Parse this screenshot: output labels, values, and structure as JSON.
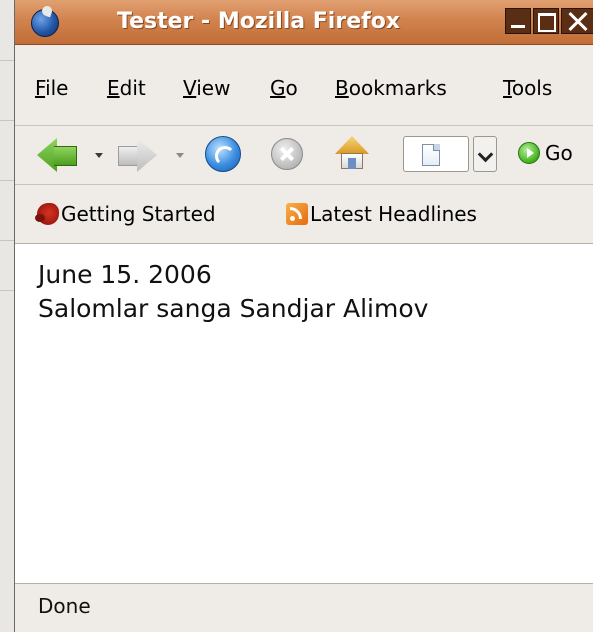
{
  "window": {
    "title": "Tester - Mozilla Firefox"
  },
  "menu": [
    {
      "label": "File",
      "underline": "F",
      "rest": "ile"
    },
    {
      "label": "Edit",
      "underline": "E",
      "rest": "dit"
    },
    {
      "label": "View",
      "underline": "V",
      "rest": "iew"
    },
    {
      "label": "Go",
      "underline": "G",
      "rest": "o"
    },
    {
      "label": "Bookmarks",
      "underline": "B",
      "rest": "ookmarks"
    },
    {
      "label": "Tools",
      "underline": "T",
      "rest": "ools"
    }
  ],
  "toolbar": {
    "go_label": "Go"
  },
  "bookmarks": [
    {
      "label": "Getting Started",
      "icon": "firefox-icon"
    },
    {
      "label": "Latest Headlines",
      "icon": "rss-icon"
    }
  ],
  "content": {
    "lines": [
      "June 15. 2006",
      "Salomlar sanga Sandjar Alimov"
    ]
  },
  "status": {
    "text": "Done"
  }
}
